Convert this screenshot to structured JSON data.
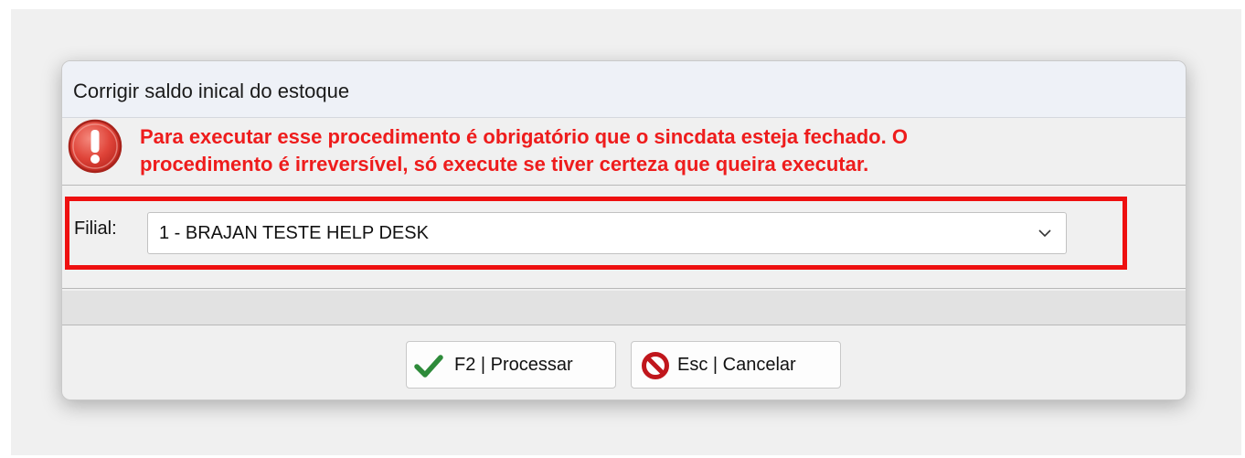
{
  "dialog": {
    "title": "Corrigir saldo inical do estoque"
  },
  "warning": {
    "icon": "exclamation-icon",
    "line1": "Para executar esse procedimento é obrigatório que o sincdata esteja fechado. O",
    "line2": "procedimento é irreversível, só execute se tiver certeza que queira executar.",
    "color": "#ee1c1c"
  },
  "filial": {
    "label": "Filial:",
    "selected": "1 - BRAJAN TESTE HELP DESK",
    "highlight_color": "#ee1010"
  },
  "buttons": {
    "process_label": "F2 | Processar",
    "process_icon": "checkmark-icon",
    "cancel_label": "Esc | Cancelar",
    "cancel_icon": "no-entry-icon"
  }
}
